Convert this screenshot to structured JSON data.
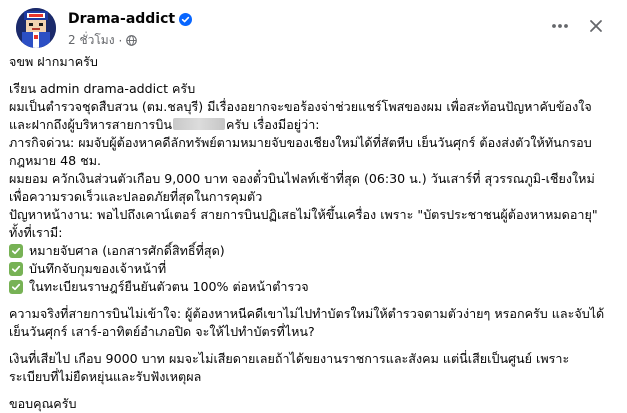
{
  "post": {
    "author": "Drama-addict",
    "time": "2 ชั่วโมง",
    "icons": {
      "verified": "verified-badge-icon",
      "audience": "globe-icon",
      "more": "more-options-icon",
      "close": "close-icon"
    },
    "colors": {
      "verified": "#0866ff",
      "check": "#77b255"
    },
    "lines": {
      "l1": "จขพ ฝากมาครับ",
      "l2": "เรียน admin drama-addict ครับ",
      "l3": "ผมเป็นตำรวจชุดสืบสวน (ตม.ชลบุรี) มีเรื่องอยากจะขอร้องจ่าช่วยแชร์โพสของผม เพื่อสะท้อนปัญหาคับข้องใจ",
      "l4a": "และฝากถึงผู้บริหารสายการบิน",
      "l4b": "ครับ เรื่องมีอยู่ว่า:",
      "l5": "ภารกิจด่วน: ผมจับผู้ต้องหาคดีลักทรัพย์ตามหมายจับของเชียงใหม่ได้ที่สัตหีบ เย็นวันศุกร์ ต้องส่งตัวให้ทันกรอบ",
      "l6": "กฎหมาย 48 ชม.",
      "l7": " ผมยอม ควักเงินส่วนตัวเกือบ 9,000 บาท จองตั๋วบินไฟลท์เช้าที่สุด (06:30 น.) วันเสาร์ที่ สุวรรณภูมิ-เชียงใหม่",
      "l8": "เพื่อความรวดเร็วและปลอดภัยที่สุดในการคุมตัว",
      "l9": "ปัญหาหน้างาน: พอไปถึงเคาน์เตอร์ สายการบินปฏิเสธไม่ให้ขึ้นเครื่อง เพราะ \"บัตรประชาชนผู้ต้องหาหมดอายุ\"",
      "l10": "ทั้งที่เรามี:",
      "c1": "หมายจับศาล (เอกสารศักดิ์สิทธิ์ที่สุด)",
      "c2": "บันทึกจับกุมของเจ้าหน้าที่",
      "c3": "ในทะเบียนราษฎร์ยืนยันตัวตน 100% ต่อหน้าตำรวจ",
      "l11": "ความจริงที่สายการบินไม่เข้าใจ: ผู้ต้องหาหนีคดีเขาไม่ไปทำบัตรใหม่ให้ตำรวจตามตัวง่ายๆ หรอกครับ และจับได้",
      "l12": "เย็นวันศุกร์ เสาร์-อาทิตย์อำเภอปิด จะให้ไปทำบัตรที่ไหน?",
      "l13": "เงินที่เสียไป เกือบ 9000 บาท ผมจะไม่เสียดายเลยถ้าได้ขยงานราชการและสังคม แต่นี่เสียเป็นศูนย์ เพราะ",
      "l14": "ระเบียบที่ไม่ยืดหยุ่นและรับฟังเหตุผล",
      "l15": "ขอบคุณครับ"
    }
  }
}
